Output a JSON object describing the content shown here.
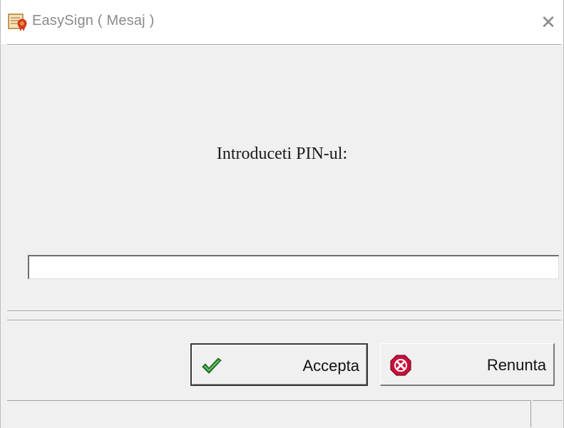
{
  "window": {
    "title": "EasySign ( Mesaj )",
    "app_icon": "certificate-ribbon-icon",
    "close_icon": "close-icon",
    "close_glyph": "✕"
  },
  "dialog": {
    "prompt": "Introduceti PIN-ul:",
    "pin_input": {
      "value": "",
      "placeholder": ""
    }
  },
  "buttons": {
    "accept": {
      "label": "Accepta",
      "icon": "green-checkmark-icon",
      "color": "#2e8b2e"
    },
    "cancel": {
      "label": "Renunta",
      "icon": "red-cancel-icon",
      "color": "#c8103a"
    }
  },
  "status_bar": {
    "text": ""
  }
}
